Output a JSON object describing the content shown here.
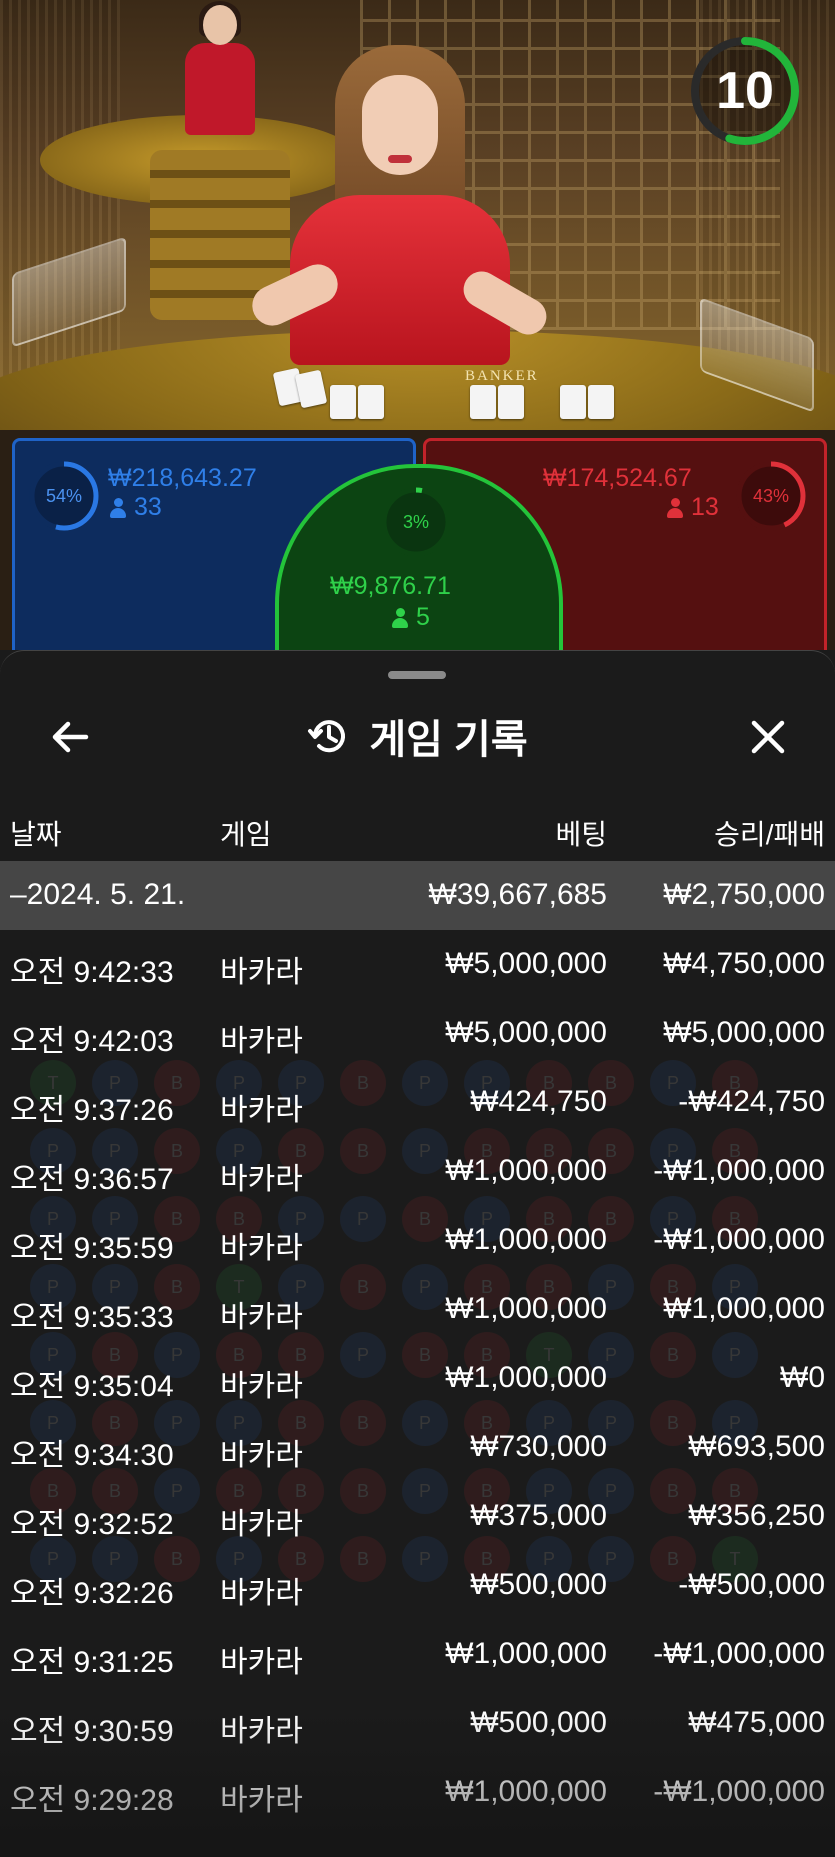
{
  "timer": {
    "value": "10",
    "fraction_remaining": 0.55
  },
  "table_text": {
    "banker": "BANKER"
  },
  "bets": {
    "player": {
      "percent": "54%",
      "amount": "₩218,643.27",
      "count": "33",
      "fraction": 0.54,
      "color": "#2a78e4"
    },
    "tie": {
      "percent": "3%",
      "amount": "₩9,876.71",
      "count": "5",
      "fraction": 0.03,
      "color": "#2fd14a"
    },
    "banker": {
      "percent": "43%",
      "amount": "₩174,524.67",
      "count": "13",
      "fraction": 0.43,
      "color": "#e0313a"
    }
  },
  "sheet": {
    "title": "게임 기록",
    "back_icon": "arrow-left-icon",
    "history_icon": "history-icon",
    "close_icon": "close-icon"
  },
  "table": {
    "headers": {
      "date": "날짜",
      "game": "게임",
      "bet": "베팅",
      "result": "승리/패배"
    },
    "date_row": {
      "date": "–2024. 5. 21.",
      "bet": "₩39,667,685",
      "result": "₩2,750,000"
    },
    "rows": [
      {
        "time": "오전 9:42:33",
        "game": "바카라",
        "bet": "₩5,000,000",
        "result": "₩4,750,000"
      },
      {
        "time": "오전 9:42:03",
        "game": "바카라",
        "bet": "₩5,000,000",
        "result": "₩5,000,000"
      },
      {
        "time": "오전 9:37:26",
        "game": "바카라",
        "bet": "₩424,750",
        "result": "-₩424,750"
      },
      {
        "time": "오전 9:36:57",
        "game": "바카라",
        "bet": "₩1,000,000",
        "result": "-₩1,000,000"
      },
      {
        "time": "오전 9:35:59",
        "game": "바카라",
        "bet": "₩1,000,000",
        "result": "-₩1,000,000"
      },
      {
        "time": "오전 9:35:33",
        "game": "바카라",
        "bet": "₩1,000,000",
        "result": "₩1,000,000"
      },
      {
        "time": "오전 9:35:04",
        "game": "바카라",
        "bet": "₩1,000,000",
        "result": "₩0"
      },
      {
        "time": "오전 9:34:30",
        "game": "바카라",
        "bet": "₩730,000",
        "result": "₩693,500"
      },
      {
        "time": "오전 9:32:52",
        "game": "바카라",
        "bet": "₩375,000",
        "result": "₩356,250"
      },
      {
        "time": "오전 9:32:26",
        "game": "바카라",
        "bet": "₩500,000",
        "result": "-₩500,000"
      },
      {
        "time": "오전 9:31:25",
        "game": "바카라",
        "bet": "₩1,000,000",
        "result": "-₩1,000,000"
      },
      {
        "time": "오전 9:30:59",
        "game": "바카라",
        "bet": "₩500,000",
        "result": "₩475,000"
      },
      {
        "time": "오전 9:29:28",
        "game": "바카라",
        "bet": "₩1,000,000",
        "result": "-₩1,000,000"
      }
    ]
  }
}
